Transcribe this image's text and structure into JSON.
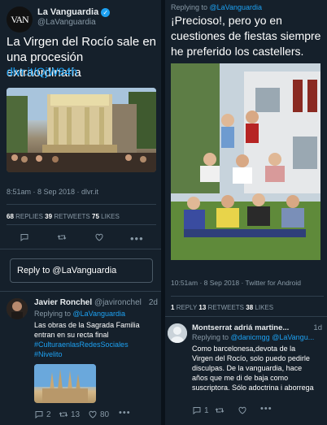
{
  "left_tweet": {
    "logo_text": "VAN",
    "account_name": "La Vanguardia",
    "handle": "@LaVanguardia",
    "text": "La Virgen del Rocío sale en una procesión extraordinaria",
    "link": "dlvr.it/QjW84h",
    "timestamp": "8:51am · 8 Sep 2018 · dlvr.it",
    "stats": {
      "replies_count": "68",
      "replies_label": "REPLIES",
      "retweets_count": "39",
      "retweets_label": "RETWEETS",
      "likes_count": "75",
      "likes_label": "LIKES"
    },
    "reply_box_placeholder": "Reply to @LaVanguardia"
  },
  "right_tweet": {
    "replying_label": "Replying to ",
    "replying_handle": "@LaVanguardia",
    "text": "¡Precioso!, pero yo en cuestiones de fiestas siempre he preferido los castellers.",
    "timestamp": "10:51am · 8 Sep 2018 · Twitter for Android",
    "stats": {
      "reply_count": "1",
      "reply_label": "REPLY",
      "retweets_count": "13",
      "retweets_label": "RETWEETS",
      "likes_count": "38",
      "likes_label": "LIKES"
    }
  },
  "reply_javier": {
    "name": "Javier Ronchel",
    "handle": "@javironchel",
    "age": "2d",
    "replying_label": "Replying to ",
    "replying_handle": "@LaVanguardia",
    "text_line1": "Las obras de la Sagrada Familia",
    "text_line2": "entran en su recta final",
    "hashtag1": "#CulturaenlasRedesSociales",
    "hashtag2": "#Nivelito",
    "replies": "2",
    "retweets": "13",
    "likes": "80"
  },
  "reply_montserrat": {
    "name": "Montserrat adriá martine...",
    "age": "1d",
    "replying_label": "Replying to ",
    "replying_handle": "@danicmgg @LaVangu...",
    "text": "Como barcelonesa,devota de la Virgen del Rocío, solo puedo pedirle disculpas. De la vanguardia, hace años que me di de baja como suscriptora. Sólo adoctrina i aborrega",
    "replies": "1"
  },
  "colors": {
    "background": "#15202b",
    "accent": "#1da1f2",
    "muted": "#8899a6"
  }
}
